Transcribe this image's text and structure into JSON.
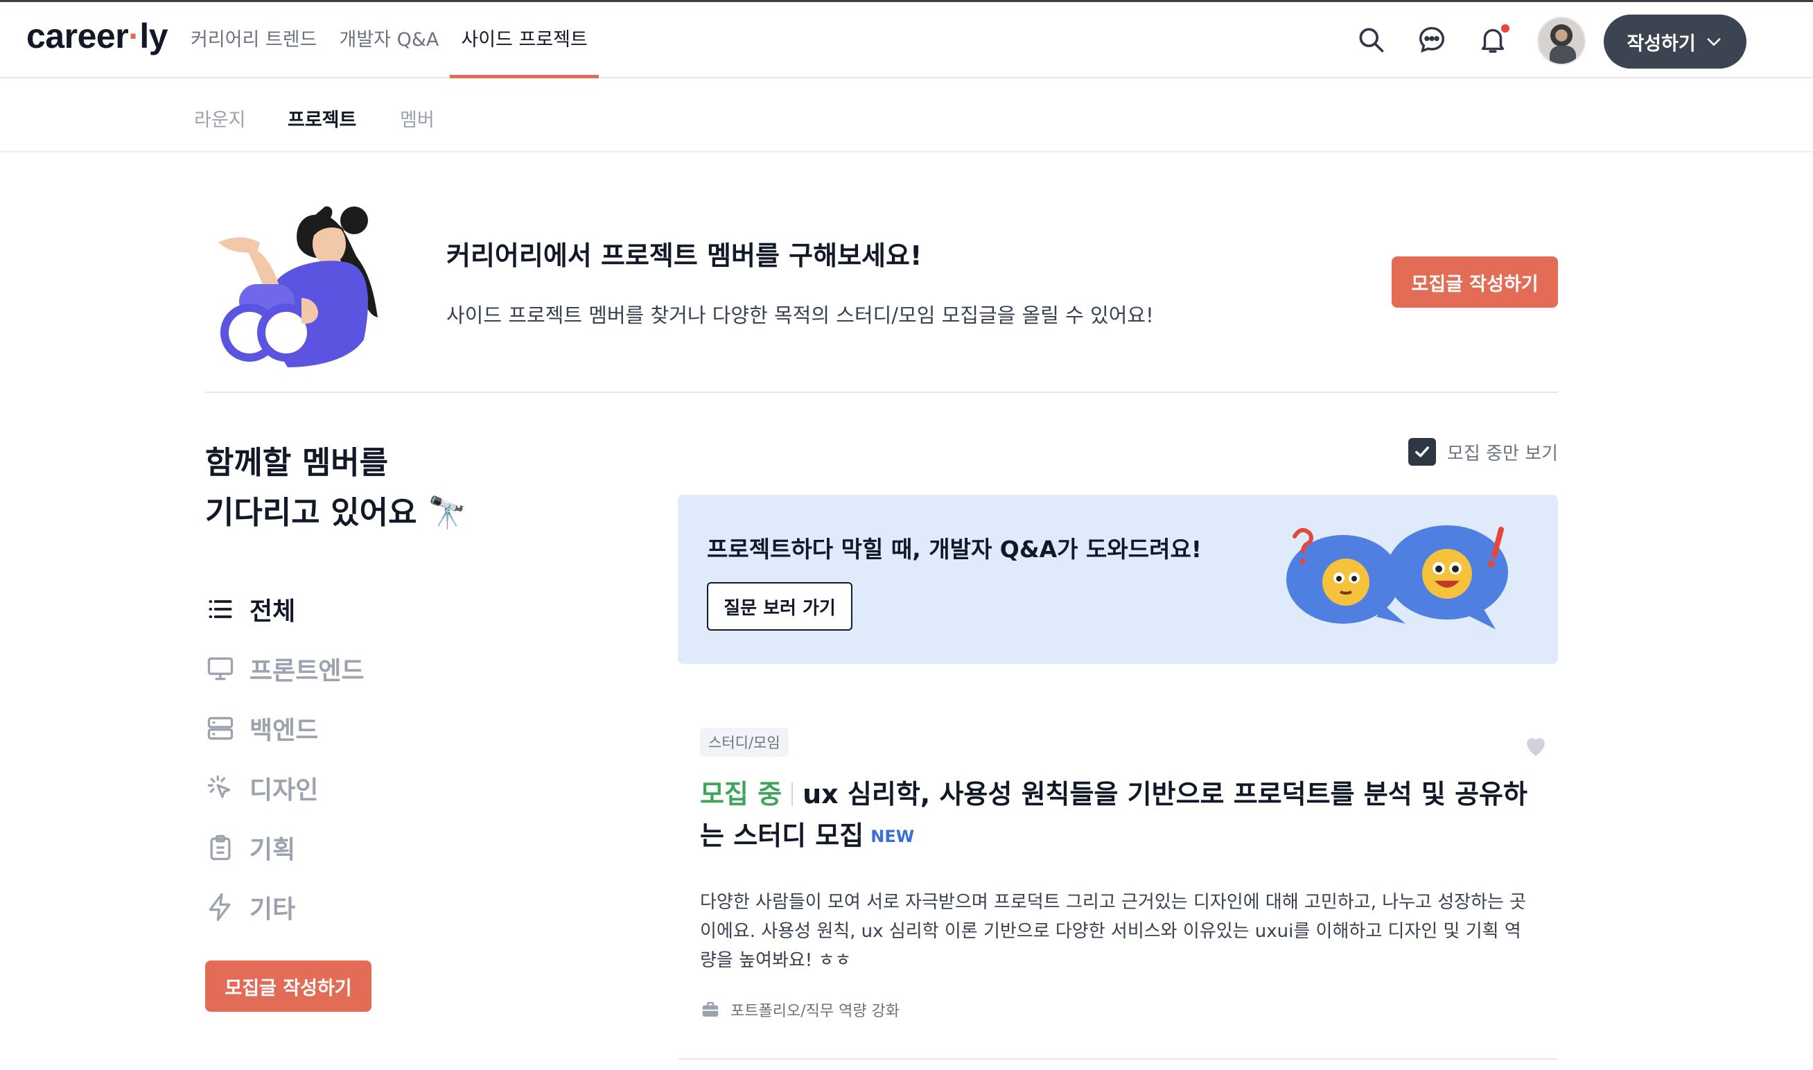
{
  "brand": {
    "logo_left": "career",
    "logo_dot": "·",
    "logo_right": "ly",
    "accent": "#e26c56"
  },
  "gnb": {
    "items": [
      "커리어리 트렌드",
      "개발자 Q&A",
      "사이드 프로젝트"
    ],
    "active_index": 2
  },
  "header": {
    "write_label": "작성하기",
    "icons": [
      "search-icon",
      "chat-icon",
      "bell-icon"
    ]
  },
  "subnav": {
    "items": [
      "라운지",
      "프로젝트",
      "멤버"
    ],
    "active_index": 1
  },
  "hero": {
    "title": "커리어리에서 프로젝트 멤버를 구해보세요!",
    "description": "사이드 프로젝트 멤버를 찾거나 다양한 목적의 스터디/모임 모집글을 올릴 수 있어요!",
    "cta": "모집글 작성하기"
  },
  "sidebar": {
    "heading_line1": "함께할 멤버를",
    "heading_line2": "기다리고 있어요 🔭",
    "categories": [
      {
        "label": "전체",
        "icon": "list-icon"
      },
      {
        "label": "프론트엔드",
        "icon": "monitor-icon"
      },
      {
        "label": "백엔드",
        "icon": "server-icon"
      },
      {
        "label": "디자인",
        "icon": "cursor-click-icon"
      },
      {
        "label": "기획",
        "icon": "clipboard-icon"
      },
      {
        "label": "기타",
        "icon": "lightning-icon"
      }
    ],
    "active_index": 0,
    "cta": "모집글 작성하기"
  },
  "filter": {
    "label": "모집 중만 보기",
    "checked": true
  },
  "banner": {
    "title": "프로젝트하다 막힐 때, 개발자 Q&A가 도와드려요!",
    "button": "질문 보러 가기"
  },
  "post": {
    "tag": "스터디/모임",
    "status": "모집 중",
    "title": "ux 심리학, 사용성 원칙들을 기반으로 프로덕트를 분석 및 공유하는 스터디 모집",
    "badge": "NEW",
    "body": "다양한 사람들이 모여 서로 자극받으며 프로덕트 그리고 근거있는 디자인에 대해 고민하고, 나누고 성장하는 곳이에요. 사용성 원칙, ux 심리학 이론 기반으로 다양한 서비스와 이유있는 uxui를 이해하고 디자인 및 기획 역량을 높여봐요! ㅎㅎ",
    "meta": "포트폴리오/직무 역량 강화"
  }
}
